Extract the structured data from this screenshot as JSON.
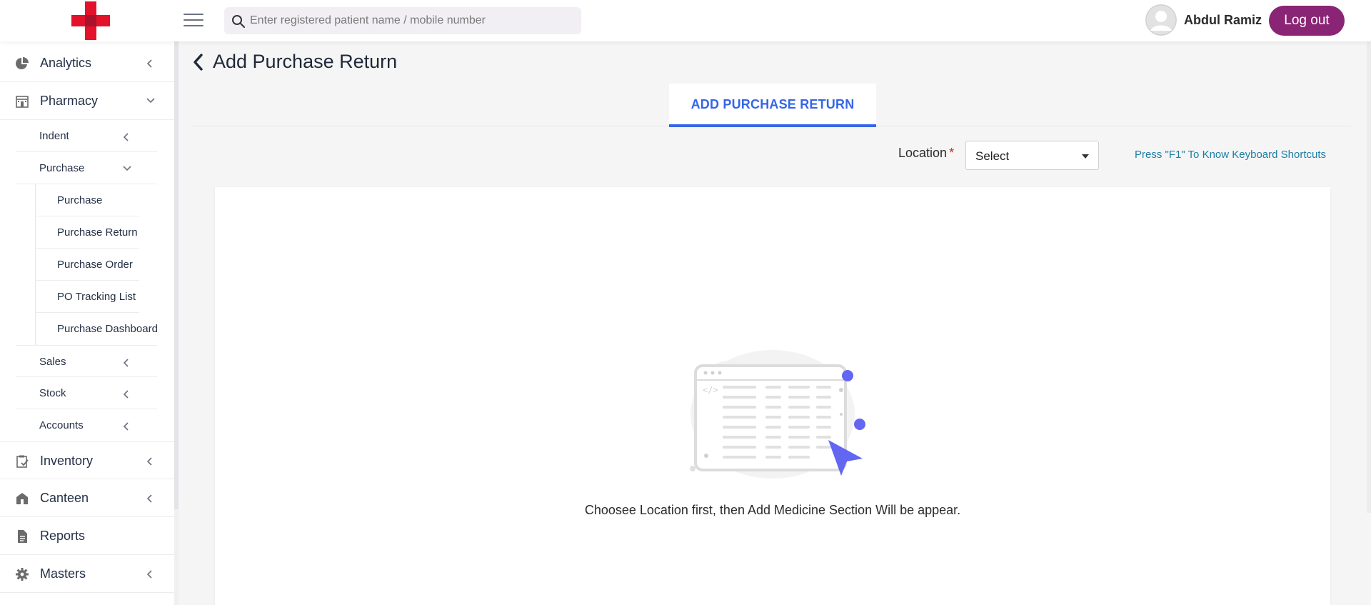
{
  "header": {
    "search_placeholder": "Enter registered patient name / mobile number",
    "user_name": "Abdul Ramiz",
    "logout_label": "Log out"
  },
  "sidebar": {
    "items": [
      {
        "label": "Analytics",
        "icon": "pie-chart-icon",
        "state": "collapsed"
      },
      {
        "label": "Pharmacy",
        "icon": "pharmacy-building-icon",
        "state": "expanded",
        "children": [
          {
            "label": "Indent",
            "state": "collapsed"
          },
          {
            "label": "Purchase",
            "state": "expanded",
            "children": [
              "Purchase",
              "Purchase Return",
              "Purchase Order",
              "PO Tracking List",
              "Purchase Dashboard"
            ]
          },
          {
            "label": "Sales",
            "state": "collapsed"
          },
          {
            "label": "Stock",
            "state": "collapsed"
          },
          {
            "label": "Accounts",
            "state": "collapsed"
          }
        ]
      },
      {
        "label": "Inventory",
        "icon": "clipboard-check-icon",
        "state": "collapsed"
      },
      {
        "label": "Canteen",
        "icon": "canteen-icon",
        "state": "collapsed"
      },
      {
        "label": "Reports",
        "icon": "document-icon"
      },
      {
        "label": "Masters",
        "icon": "gear-icon",
        "state": "collapsed"
      }
    ]
  },
  "main": {
    "title": "Add Purchase Return",
    "tab_label": "ADD PURCHASE RETURN",
    "location_label": "Location",
    "required_mark": "*",
    "location_value": "Select",
    "shortcut_hint": "Press \"F1\" To Know Keyboard Shortcuts",
    "empty_message": "Choosee Location first, then Add Medicine Section Will be appear."
  },
  "colors": {
    "accent": "#3566e8",
    "logout": "#8a2475",
    "logo_red": "#e3122a",
    "link": "#1c7fa6",
    "illustration_accent": "#6366f1"
  }
}
